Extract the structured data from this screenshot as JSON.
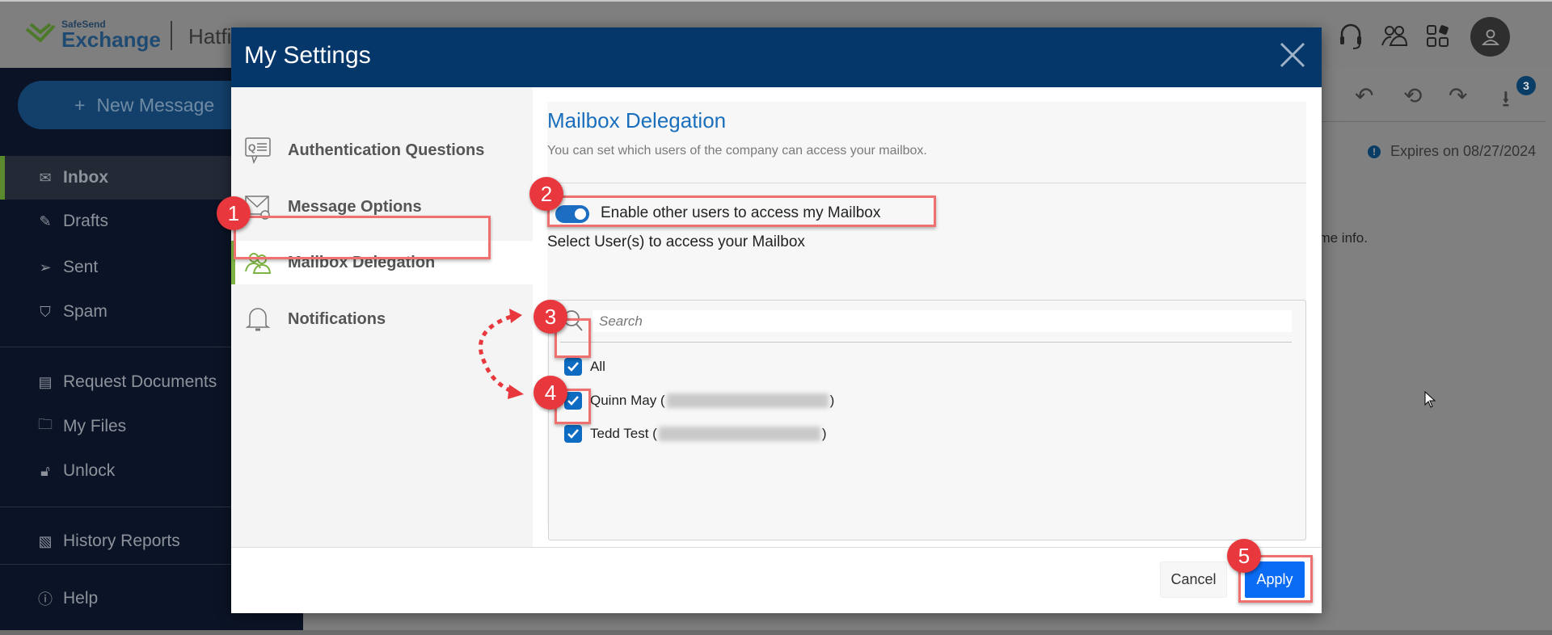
{
  "app": {
    "logo_top": "SafeSend",
    "logo_bottom": "Exchange",
    "org": "Hatfi"
  },
  "header_icons": [
    "headset-icon",
    "people-icon",
    "apps-icon",
    "avatar-icon"
  ],
  "sidebar": {
    "new_message": "New Message",
    "items": [
      {
        "label": "Inbox",
        "icon": "envelope-icon",
        "active": true
      },
      {
        "label": "Drafts",
        "icon": "pencil-icon"
      },
      {
        "label": "Sent",
        "icon": "send-icon"
      },
      {
        "label": "Spam",
        "icon": "shield-icon"
      },
      {
        "label": "Request Documents",
        "icon": "document-icon"
      },
      {
        "label": "My Files",
        "icon": "folder-icon"
      },
      {
        "label": "Unlock",
        "icon": "unlock-icon"
      },
      {
        "label": "History Reports",
        "icon": "report-icon"
      },
      {
        "label": "Help",
        "icon": "help-icon"
      }
    ]
  },
  "message": {
    "expires": "Expires on 08/27/2024",
    "body_fragment": "ome info.",
    "download_count": "3"
  },
  "modal": {
    "title": "My Settings",
    "nav": [
      {
        "label": "Authentication Questions",
        "icon": "qa-icon"
      },
      {
        "label": "Message Options",
        "icon": "mail-settings-icon"
      },
      {
        "label": "Mailbox Delegation",
        "icon": "users-icon",
        "active": true
      },
      {
        "label": "Notifications",
        "icon": "bell-icon"
      }
    ],
    "section_title": "Mailbox Delegation",
    "description": "You can set which users of the company can access your mailbox.",
    "toggle_label": "Enable other users to access my Mailbox",
    "toggle_on": true,
    "select_label": "Select User(s) to access your Mailbox",
    "search_placeholder": "Search",
    "users": [
      {
        "name": "All",
        "checked": true
      },
      {
        "name": "Quinn May (",
        "suffix": ")",
        "checked": true
      },
      {
        "name": "Tedd Test (",
        "suffix": ")",
        "checked": true
      }
    ],
    "cancel": "Cancel",
    "apply": "Apply"
  },
  "annotations": [
    "1",
    "2",
    "3",
    "4",
    "5"
  ],
  "colors": {
    "header": "#05376a",
    "accent": "#1a6fbd",
    "apply": "#0a6cf5",
    "annotation": "#e8383d",
    "active_green": "#7cb342"
  }
}
